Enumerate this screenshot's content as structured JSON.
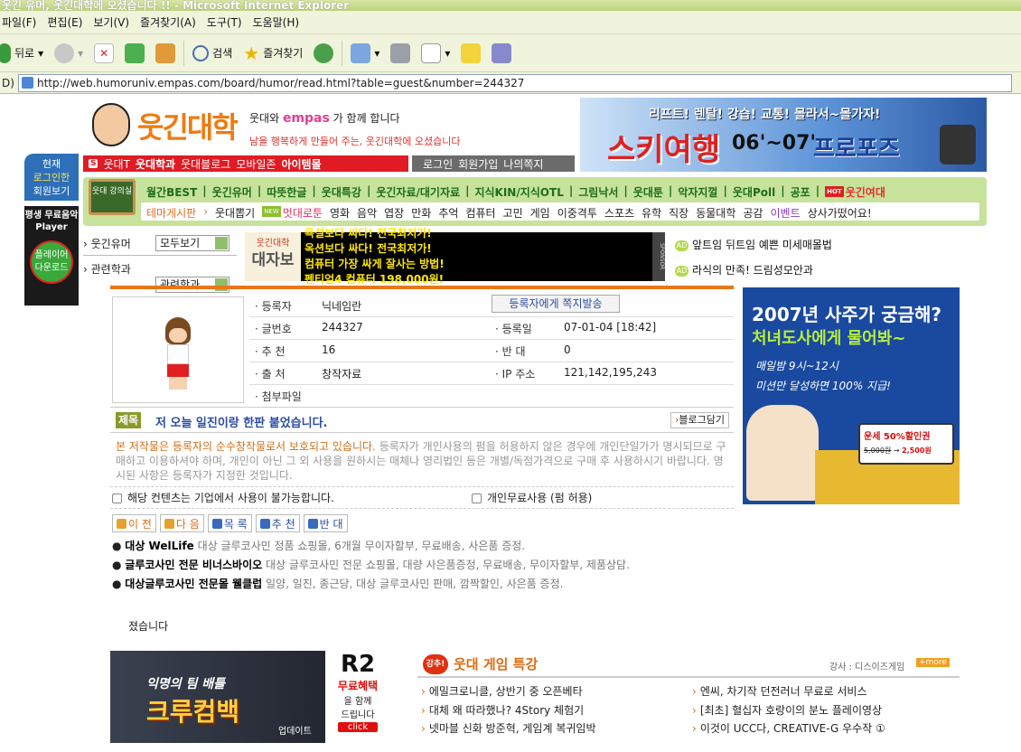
{
  "window": {
    "title": "웃긴 유머, 웃긴대학에 오셨습니다 !! - Microsoft Internet Explorer"
  },
  "menubar": [
    "파일(F)",
    "편집(E)",
    "보기(V)",
    "즐겨찾기(A)",
    "도구(T)",
    "도움말(H)"
  ],
  "toolbar": {
    "back": "뒤로",
    "search": "검색",
    "favorites": "즐겨찾기"
  },
  "address": {
    "label": "D)",
    "url": "http://web.humoruniv.empas.com/board/humor/read.html?table=guest&number=244327"
  },
  "header": {
    "logo": "웃긴대학",
    "logo_tagline": "웃대와",
    "logo_tagline_brand": "empas",
    "logo_tagline_end": "가 함께 합니다",
    "logo_sub": "남을 행복하게 만들어 주는, 웃긴대학에 오셨습니다",
    "ski_banner": "리프트! 렌탈! 강습! 교통! 몰라서~몰가자!",
    "ski_title": "스키여행",
    "ski_year": "06'~07'",
    "ski_proposal": "프로포즈"
  },
  "nav_red": [
    "웃대T",
    "웃대학과",
    "웃대블로그",
    "모바일존",
    "아이템몰"
  ],
  "nav_gray": [
    "로그인",
    "회원가입",
    "나의쪽지"
  ],
  "menu_green": {
    "badge": "웃대 강의실",
    "main": [
      "월간BEST",
      "웃긴유머",
      "따뜻한글",
      "웃대특강",
      "웃긴자료/대기자료",
      "지식KIN/지식OTL",
      "그림낙서",
      "웃대툰",
      "악자지껄",
      "웃대Poll",
      "공포",
      "웃긴여대"
    ],
    "theme_label": "테마게시판",
    "theme": [
      "웃대뽑기",
      "멋대로툰",
      "영화",
      "음악",
      "엽장",
      "만화",
      "추억",
      "컴퓨터",
      "고민",
      "게임",
      "이중격투",
      "스포츠",
      "유학",
      "직장",
      "동물대학",
      "공감",
      "이벤트",
      "상사가떴어요!"
    ],
    "hot": "HOT",
    "new": "NEW"
  },
  "leftside": {
    "now": "현재",
    "login": "로그인한",
    "member": "회원보기",
    "music": "평생 무료음악 Player",
    "player": "플레이어",
    "download": "다운로드"
  },
  "selects": {
    "row1_label": "웃긴유머",
    "row1_value": "모두보기",
    "row2_label": "관련학과",
    "row2_value": "관련학과"
  },
  "sponsor": {
    "l0": "욕설보다 싸다! 전국최저가!",
    "l1": "옥션보다 싸다! 전국최저가!",
    "l2": "컴퓨터 가장 싸게 잘사는 방법!",
    "l3": "펜티엄4 컴퓨터 198,000원!",
    "badge": "웃긴대학",
    "badge2": "대자보",
    "sponsor_tag": "SPONSOR"
  },
  "side_ads": {
    "tag": "AD",
    "a1": "앞트임 뒤트임 예쁜 미세매몰법",
    "a2": "라식의 만족! 드림성모안과"
  },
  "post": {
    "labels": {
      "author": "· 등록자",
      "number": "· 글번호",
      "date": "· 등록일",
      "recommend": "· 추 천",
      "oppose": "· 반 대",
      "source": "· 출 처",
      "ip": "· IP 주소",
      "attach": "· 첨부파일"
    },
    "author": "닉네임란",
    "message_btn": "등록자에게 쪽지발송",
    "number": "244327",
    "date": "07-01-04 [18:42]",
    "recommend": "16",
    "oppose": "0",
    "source": "창작자료",
    "ip": "121,142,195,243",
    "title_label": "제목",
    "title": "저 오늘 일진이랑 한판 붙었습니다.",
    "blog_btn": "블로그담기",
    "copyright_orange": "본 저작물은 등록자의 순수창작물로서 보호되고 있습니다.",
    "copyright_rest": "등록자가 개인사용의 펌을 허용하지 않은 경우에 개인단일가가 명시되므로 구매하고 이용하셔야 하며, 개인이 아닌 그 외 사용을 원하시는 매체나 영리법인 등은 개별/독점가격으로 구매 후 사용하시기 바랍니다. 명시된 사항은 등록자가 지정한 것입니다.",
    "note_corp": "해당 컨텐츠는 기업에서 사용이 불가능합니다.",
    "note_free": "개인무료사용 (펌 허용)"
  },
  "buttons": [
    "이 전",
    "다 음",
    "목 록",
    "추 천",
    "반 대"
  ],
  "links": [
    {
      "bold": "대상 WelLife",
      "text": "대상 글루코사민 정품 쇼핑몰, 6개월 무이자할부, 무료배송, 사은품 증정."
    },
    {
      "bold": "글루코사민 전문 비너스바이오",
      "text": "대상 글루코사민 전문 쇼핑몰, 대량 사은품증정, 무료배송, 무이자할부, 제품상담."
    },
    {
      "bold": "대상글루코사민 전문몰 웰클럽",
      "text": "일양, 일진, 종근당, 대상 글루코사민 판매, 깜짝할인, 사은품 증정."
    }
  ],
  "body_text": "졌습니다",
  "right_ad": {
    "l1": "2007년 사주가 궁금해?",
    "l2": "처녀도사에게 물어봐~",
    "l3": "매일밤 9시~12시",
    "l4": "미션만 달성하면 100% 지급!",
    "sale": "운세 50%할인권",
    "price_old": "5,000원",
    "price_new": "2,500원"
  },
  "bottom_banner": {
    "brand": "R2",
    "title": "크루컴백",
    "sub": "익명의 팀 배틀",
    "update": "업데이트",
    "free": "무료혜택",
    "with": "을 함께",
    "give": "드립니다",
    "click": "click"
  },
  "game": {
    "badge": "강추!",
    "title": "웃대 게임 특강",
    "lecturer": "강사 : 디스이즈게임",
    "more": "+more",
    "items": [
      "에밀크로니클, 상반기 중 오픈베타",
      "엔씨, 차기작 던전러너 무료로 서비스",
      "대체 왜 따라했나? 4Story 체험기",
      "[최초] 혈십자 호랑이의 분노 플레이영상",
      "넷마블 신화 방준혁, 게임계 복귀임박",
      "이것이 UCC다, CREATIVE-G 우수작 ①"
    ]
  },
  "colors": {
    "red": "#e01b24",
    "green": "#c7e29a",
    "orange": "#f07010",
    "navy": "#1a4aa0"
  }
}
